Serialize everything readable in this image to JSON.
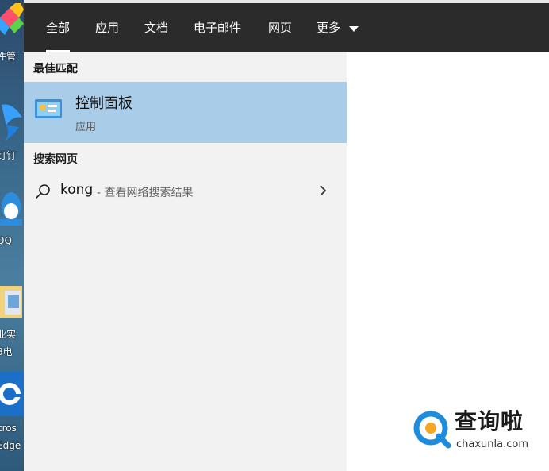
{
  "desktop": {
    "icons": [
      {
        "name": "file-manager",
        "label": "件管"
      },
      {
        "name": "dingtalk",
        "label": "钉钉"
      },
      {
        "name": "qq",
        "label": "QQ"
      },
      {
        "name": "folder",
        "label": "业实\n8电"
      },
      {
        "name": "edge",
        "label": "cros\nEdge"
      }
    ]
  },
  "tabs": [
    {
      "label": "全部",
      "active": true
    },
    {
      "label": "应用"
    },
    {
      "label": "文档"
    },
    {
      "label": "电子邮件"
    },
    {
      "label": "网页"
    },
    {
      "label": "更多"
    }
  ],
  "best_match": {
    "section_title": "最佳匹配",
    "title": "控制面板",
    "subtitle": "应用",
    "icon": "control-panel-icon"
  },
  "web": {
    "section_title": "搜索网页",
    "query": "kong",
    "description": "- 查看网络搜索结果",
    "icon": "search-icon"
  },
  "watermark": {
    "brand": "查询啦",
    "domain": "chaxunla.com"
  },
  "colors": {
    "topbar": "#2b2b2b",
    "highlight": "#a9cde9",
    "panel": "#f2f2f2"
  }
}
